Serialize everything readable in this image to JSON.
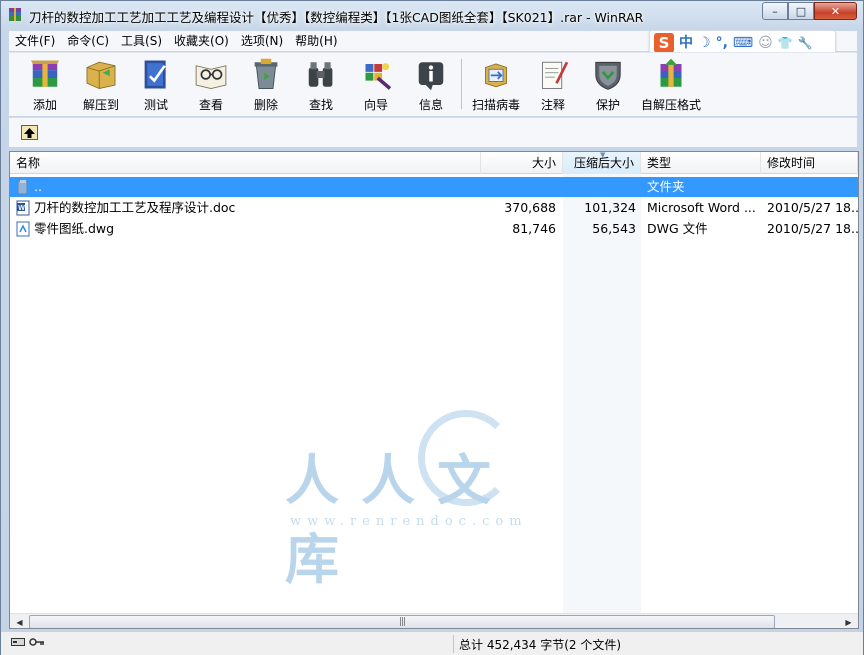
{
  "window": {
    "title": "刀杆的数控加工工艺加工工艺及编程设计【优秀】【数控编程类】【1张CAD图纸全套】【SK021】.rar - WinRAR",
    "min_glyph": "–",
    "max_glyph": "□",
    "close_glyph": "✕"
  },
  "menu": [
    "文件(F)",
    "命令(C)",
    "工具(S)",
    "收藏夹(O)",
    "选项(N)",
    "帮助(H)"
  ],
  "ime": {
    "logo": "S",
    "mode": "中",
    "moon": "☽",
    "punct": "°,",
    "keyboard": "⌨",
    "user": "☺",
    "shirt": "👕",
    "wrench": "🔧"
  },
  "toolbar": [
    {
      "label": "添加",
      "icon": "add-archive-icon"
    },
    {
      "label": "解压到",
      "icon": "extract-to-icon"
    },
    {
      "label": "测试",
      "icon": "test-icon"
    },
    {
      "label": "查看",
      "icon": "view-icon"
    },
    {
      "label": "删除",
      "icon": "delete-icon"
    },
    {
      "label": "查找",
      "icon": "find-icon"
    },
    {
      "label": "向导",
      "icon": "wizard-icon"
    },
    {
      "label": "信息",
      "icon": "info-icon"
    },
    {
      "label": "扫描病毒",
      "icon": "virus-scan-icon"
    },
    {
      "label": "注释",
      "icon": "comment-icon"
    },
    {
      "label": "保护",
      "icon": "protect-icon"
    },
    {
      "label": "自解压格式",
      "icon": "sfx-icon"
    }
  ],
  "columns": {
    "name": "名称",
    "size": "大小",
    "packed": "压缩后大小",
    "type": "类型",
    "modified": "修改时间"
  },
  "rows": [
    {
      "name": "..",
      "size": "",
      "packed": "",
      "type": "文件夹",
      "modified": ""
    },
    {
      "name": "刀杆的数控加工工艺及程序设计.doc",
      "size": "370,688",
      "packed": "101,324",
      "type": "Microsoft Word ...",
      "modified": "2010/5/27 18..."
    },
    {
      "name": "零件图纸.dwg",
      "size": "81,746",
      "packed": "56,543",
      "type": "DWG 文件",
      "modified": "2010/5/27 18..."
    }
  ],
  "watermark": {
    "text": "人人文库",
    "url": "www.renrendoc.com"
  },
  "status": {
    "summary": "总计 452,434 字节(2 个文件)"
  },
  "colors": {
    "selection": "#3399ff",
    "titlebar": "#c4d3e6",
    "close": "#c7422a"
  }
}
